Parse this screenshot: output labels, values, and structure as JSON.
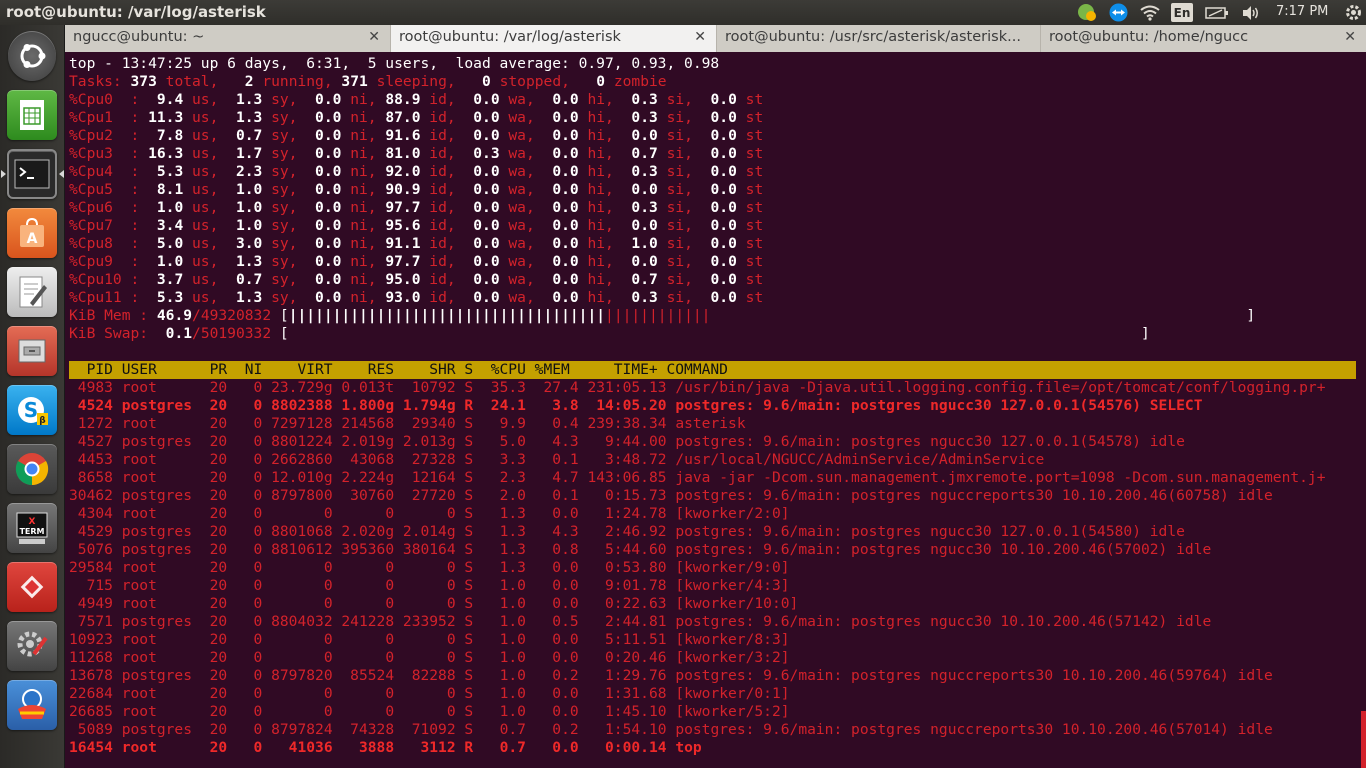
{
  "window": {
    "title": "root@ubuntu: /var/log/asterisk"
  },
  "panel": {
    "keyboard": "En",
    "clock": "7:17 PM"
  },
  "tabs": [
    {
      "label": "ngucc@ubuntu: ~",
      "active": false
    },
    {
      "label": "root@ubuntu: /var/log/asterisk",
      "active": true
    },
    {
      "label": "root@ubuntu: /usr/src/asterisk/asterisk...",
      "active": false
    },
    {
      "label": "root@ubuntu: /home/ngucc",
      "active": false
    }
  ],
  "launcher": {
    "items": [
      "ubuntu-dash-icon",
      "libreoffice-calc-icon",
      "terminal-icon",
      "software-center-icon",
      "text-editor-icon",
      "files-icon",
      "skype-icon",
      "chrome-icon",
      "xterm-icon",
      "anydesk-icon",
      "system-settings-icon",
      "rescue-icon"
    ]
  },
  "colors": {
    "background": "#300a24",
    "dim_red": "#d3222b",
    "header_bar": "#c4a000"
  },
  "top": {
    "summary": "top - 13:47:25 up 6 days,  6:31,  5 users,  load average: 0.97, 0.93, 0.98",
    "tasks": {
      "total": "373",
      "running": "2",
      "sleeping": "371",
      "stopped": "0",
      "zombie": "0"
    },
    "cpus": [
      {
        "name": "%Cpu0",
        "us": "9.4",
        "sy": "1.3",
        "ni": "0.0",
        "id": "88.9",
        "wa": "0.0",
        "hi": "0.0",
        "si": "0.3",
        "st": "0.0"
      },
      {
        "name": "%Cpu1",
        "us": "11.3",
        "sy": "1.3",
        "ni": "0.0",
        "id": "87.0",
        "wa": "0.0",
        "hi": "0.0",
        "si": "0.3",
        "st": "0.0"
      },
      {
        "name": "%Cpu2",
        "us": "7.8",
        "sy": "0.7",
        "ni": "0.0",
        "id": "91.6",
        "wa": "0.0",
        "hi": "0.0",
        "si": "0.0",
        "st": "0.0"
      },
      {
        "name": "%Cpu3",
        "us": "16.3",
        "sy": "1.7",
        "ni": "0.0",
        "id": "81.0",
        "wa": "0.3",
        "hi": "0.0",
        "si": "0.7",
        "st": "0.0"
      },
      {
        "name": "%Cpu4",
        "us": "5.3",
        "sy": "2.3",
        "ni": "0.0",
        "id": "92.0",
        "wa": "0.0",
        "hi": "0.0",
        "si": "0.3",
        "st": "0.0"
      },
      {
        "name": "%Cpu5",
        "us": "8.1",
        "sy": "1.0",
        "ni": "0.0",
        "id": "90.9",
        "wa": "0.0",
        "hi": "0.0",
        "si": "0.0",
        "st": "0.0"
      },
      {
        "name": "%Cpu6",
        "us": "1.0",
        "sy": "1.0",
        "ni": "0.0",
        "id": "97.7",
        "wa": "0.0",
        "hi": "0.0",
        "si": "0.3",
        "st": "0.0"
      },
      {
        "name": "%Cpu7",
        "us": "3.4",
        "sy": "1.0",
        "ni": "0.0",
        "id": "95.6",
        "wa": "0.0",
        "hi": "0.0",
        "si": "0.0",
        "st": "0.0"
      },
      {
        "name": "%Cpu8",
        "us": "5.0",
        "sy": "3.0",
        "ni": "0.0",
        "id": "91.1",
        "wa": "0.0",
        "hi": "0.0",
        "si": "1.0",
        "st": "0.0"
      },
      {
        "name": "%Cpu9",
        "us": "1.0",
        "sy": "1.3",
        "ni": "0.0",
        "id": "97.7",
        "wa": "0.0",
        "hi": "0.0",
        "si": "0.0",
        "st": "0.0"
      },
      {
        "name": "%Cpu10",
        "us": "3.7",
        "sy": "0.7",
        "ni": "0.0",
        "id": "95.0",
        "wa": "0.0",
        "hi": "0.0",
        "si": "0.7",
        "st": "0.0"
      },
      {
        "name": "%Cpu11",
        "us": "5.3",
        "sy": "1.3",
        "ni": "0.0",
        "id": "93.0",
        "wa": "0.0",
        "hi": "0.0",
        "si": "0.3",
        "st": "0.0"
      }
    ],
    "mem": {
      "label": "KiB Mem :",
      "used_pct": "46.9",
      "total": "49320832",
      "bar_bold": "||||||||||||||||||||||||||||||||||||",
      "bar_dim": "||||||||||||"
    },
    "swap": {
      "label": "KiB Swap:",
      "used_pct": "0.1",
      "total": "50190332"
    },
    "columns": [
      "PID",
      "USER",
      "PR",
      "NI",
      "VIRT",
      "RES",
      "SHR",
      "S",
      "%CPU",
      "%MEM",
      "TIME+",
      "COMMAND"
    ],
    "processes": [
      {
        "pid": "4983",
        "user": "root",
        "pr": "20",
        "ni": "0",
        "virt": "23.729g",
        "res": "0.013t",
        "shr": "10792",
        "s": "S",
        "cpu": "35.3",
        "mem": "27.4",
        "time": "231:05.13",
        "cmd": "/usr/bin/java -Djava.util.logging.config.file=/opt/tomcat/conf/logging.pr+",
        "bold": false
      },
      {
        "pid": "4524",
        "user": "postgres",
        "pr": "20",
        "ni": "0",
        "virt": "8802388",
        "res": "1.800g",
        "shr": "1.794g",
        "s": "R",
        "cpu": "24.1",
        "mem": "3.8",
        "time": "14:05.20",
        "cmd": "postgres: 9.6/main: postgres ngucc30 127.0.0.1(54576) SELECT",
        "bold": true
      },
      {
        "pid": "1272",
        "user": "root",
        "pr": "20",
        "ni": "0",
        "virt": "7297128",
        "res": "214568",
        "shr": "29340",
        "s": "S",
        "cpu": "9.9",
        "mem": "0.4",
        "time": "239:38.34",
        "cmd": "asterisk",
        "bold": false
      },
      {
        "pid": "4527",
        "user": "postgres",
        "pr": "20",
        "ni": "0",
        "virt": "8801224",
        "res": "2.019g",
        "shr": "2.013g",
        "s": "S",
        "cpu": "5.0",
        "mem": "4.3",
        "time": "9:44.00",
        "cmd": "postgres: 9.6/main: postgres ngucc30 127.0.0.1(54578) idle",
        "bold": false
      },
      {
        "pid": "4453",
        "user": "root",
        "pr": "20",
        "ni": "0",
        "virt": "2662860",
        "res": "43068",
        "shr": "27328",
        "s": "S",
        "cpu": "3.3",
        "mem": "0.1",
        "time": "3:48.72",
        "cmd": "/usr/local/NGUCC/AdminService/AdminService",
        "bold": false
      },
      {
        "pid": "8658",
        "user": "root",
        "pr": "20",
        "ni": "0",
        "virt": "12.010g",
        "res": "2.224g",
        "shr": "12164",
        "s": "S",
        "cpu": "2.3",
        "mem": "4.7",
        "time": "143:06.85",
        "cmd": "java -jar -Dcom.sun.management.jmxremote.port=1098 -Dcom.sun.management.j+",
        "bold": false
      },
      {
        "pid": "30462",
        "user": "postgres",
        "pr": "20",
        "ni": "0",
        "virt": "8797800",
        "res": "30760",
        "shr": "27720",
        "s": "S",
        "cpu": "2.0",
        "mem": "0.1",
        "time": "0:15.73",
        "cmd": "postgres: 9.6/main: postgres nguccreports30 10.10.200.46(60758) idle",
        "bold": false
      },
      {
        "pid": "4304",
        "user": "root",
        "pr": "20",
        "ni": "0",
        "virt": "0",
        "res": "0",
        "shr": "0",
        "s": "S",
        "cpu": "1.3",
        "mem": "0.0",
        "time": "1:24.78",
        "cmd": "[kworker/2:0]",
        "bold": false
      },
      {
        "pid": "4529",
        "user": "postgres",
        "pr": "20",
        "ni": "0",
        "virt": "8801068",
        "res": "2.020g",
        "shr": "2.014g",
        "s": "S",
        "cpu": "1.3",
        "mem": "4.3",
        "time": "2:46.92",
        "cmd": "postgres: 9.6/main: postgres ngucc30 127.0.0.1(54580) idle",
        "bold": false
      },
      {
        "pid": "5076",
        "user": "postgres",
        "pr": "20",
        "ni": "0",
        "virt": "8810612",
        "res": "395360",
        "shr": "380164",
        "s": "S",
        "cpu": "1.3",
        "mem": "0.8",
        "time": "5:44.60",
        "cmd": "postgres: 9.6/main: postgres ngucc30 10.10.200.46(57002) idle",
        "bold": false
      },
      {
        "pid": "29584",
        "user": "root",
        "pr": "20",
        "ni": "0",
        "virt": "0",
        "res": "0",
        "shr": "0",
        "s": "S",
        "cpu": "1.3",
        "mem": "0.0",
        "time": "0:53.80",
        "cmd": "[kworker/9:0]",
        "bold": false
      },
      {
        "pid": "715",
        "user": "root",
        "pr": "20",
        "ni": "0",
        "virt": "0",
        "res": "0",
        "shr": "0",
        "s": "S",
        "cpu": "1.0",
        "mem": "0.0",
        "time": "9:01.78",
        "cmd": "[kworker/4:3]",
        "bold": false
      },
      {
        "pid": "4949",
        "user": "root",
        "pr": "20",
        "ni": "0",
        "virt": "0",
        "res": "0",
        "shr": "0",
        "s": "S",
        "cpu": "1.0",
        "mem": "0.0",
        "time": "0:22.63",
        "cmd": "[kworker/10:0]",
        "bold": false
      },
      {
        "pid": "7571",
        "user": "postgres",
        "pr": "20",
        "ni": "0",
        "virt": "8804032",
        "res": "241228",
        "shr": "233952",
        "s": "S",
        "cpu": "1.0",
        "mem": "0.5",
        "time": "2:44.81",
        "cmd": "postgres: 9.6/main: postgres ngucc30 10.10.200.46(57142) idle",
        "bold": false
      },
      {
        "pid": "10923",
        "user": "root",
        "pr": "20",
        "ni": "0",
        "virt": "0",
        "res": "0",
        "shr": "0",
        "s": "S",
        "cpu": "1.0",
        "mem": "0.0",
        "time": "5:11.51",
        "cmd": "[kworker/8:3]",
        "bold": false
      },
      {
        "pid": "11268",
        "user": "root",
        "pr": "20",
        "ni": "0",
        "virt": "0",
        "res": "0",
        "shr": "0",
        "s": "S",
        "cpu": "1.0",
        "mem": "0.0",
        "time": "0:20.46",
        "cmd": "[kworker/3:2]",
        "bold": false
      },
      {
        "pid": "13678",
        "user": "postgres",
        "pr": "20",
        "ni": "0",
        "virt": "8797820",
        "res": "85524",
        "shr": "82288",
        "s": "S",
        "cpu": "1.0",
        "mem": "0.2",
        "time": "1:29.76",
        "cmd": "postgres: 9.6/main: postgres nguccreports30 10.10.200.46(59764) idle",
        "bold": false
      },
      {
        "pid": "22684",
        "user": "root",
        "pr": "20",
        "ni": "0",
        "virt": "0",
        "res": "0",
        "shr": "0",
        "s": "S",
        "cpu": "1.0",
        "mem": "0.0",
        "time": "1:31.68",
        "cmd": "[kworker/0:1]",
        "bold": false
      },
      {
        "pid": "26685",
        "user": "root",
        "pr": "20",
        "ni": "0",
        "virt": "0",
        "res": "0",
        "shr": "0",
        "s": "S",
        "cpu": "1.0",
        "mem": "0.0",
        "time": "1:45.10",
        "cmd": "[kworker/5:2]",
        "bold": false
      },
      {
        "pid": "5089",
        "user": "postgres",
        "pr": "20",
        "ni": "0",
        "virt": "8797824",
        "res": "74328",
        "shr": "71092",
        "s": "S",
        "cpu": "0.7",
        "mem": "0.2",
        "time": "1:54.10",
        "cmd": "postgres: 9.6/main: postgres nguccreports30 10.10.200.46(57014) idle",
        "bold": false
      },
      {
        "pid": "16454",
        "user": "root",
        "pr": "20",
        "ni": "0",
        "virt": "41036",
        "res": "3888",
        "shr": "3112",
        "s": "R",
        "cpu": "0.7",
        "mem": "0.0",
        "time": "0:00.14",
        "cmd": "top",
        "bold": true
      }
    ]
  }
}
